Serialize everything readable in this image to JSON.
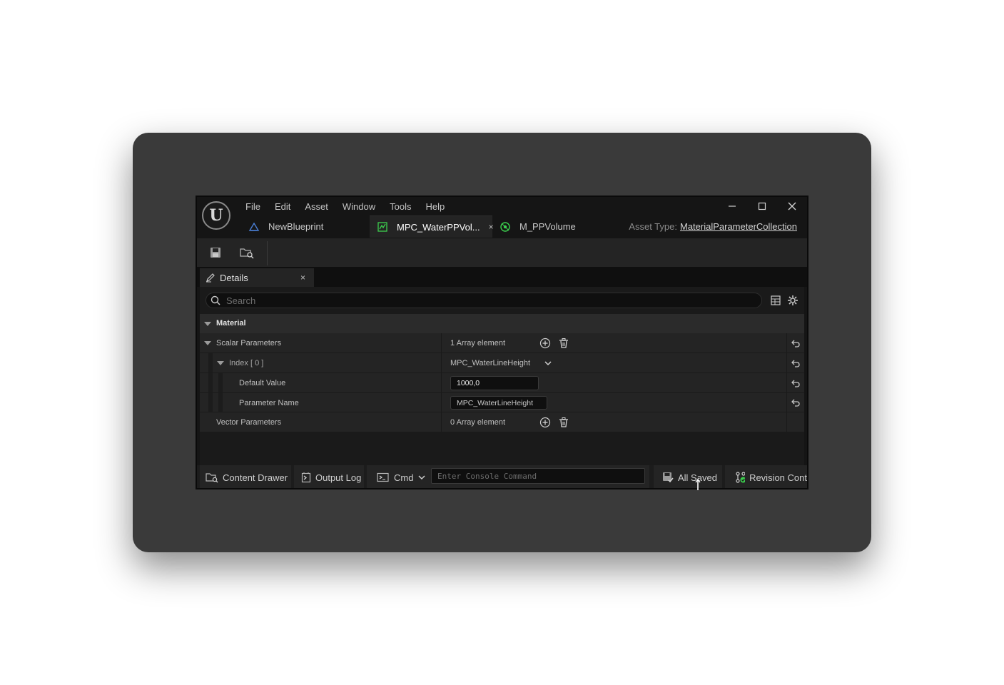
{
  "menu": [
    "File",
    "Edit",
    "Asset",
    "Window",
    "Tools",
    "Help"
  ],
  "tabs": [
    {
      "label": "NewBlueprint",
      "icon": "blueprint-icon"
    },
    {
      "label": "MPC_WaterPPVol...",
      "icon": "material-parameter-collection-icon",
      "close": "×"
    },
    {
      "label": "M_PPVolume",
      "icon": "material-icon"
    }
  ],
  "asset_type": {
    "label": "Asset Type:",
    "value": "MaterialParameterCollection"
  },
  "details": {
    "tab_label": "Details",
    "close": "×",
    "search_placeholder": "Search",
    "category": "Material",
    "scalar": {
      "label": "Scalar Parameters",
      "count": "1 Array element"
    },
    "index": {
      "label": "Index [ 0 ]",
      "value": "MPC_WaterLineHeight"
    },
    "default_value": {
      "label": "Default Value",
      "value": "1000,0"
    },
    "parameter_name": {
      "label": "Parameter Name",
      "value": "MPC_WaterLineHeight"
    },
    "vector": {
      "label": "Vector Parameters",
      "count": "0 Array element"
    }
  },
  "bottom": {
    "content_drawer": "Content Drawer",
    "output_log": "Output Log",
    "cmd": "Cmd",
    "console_placeholder": "Enter Console Command",
    "all_saved": "All Saved",
    "revision": "Revision Cont"
  },
  "colors": {
    "accent_green": "#3ccf4e",
    "blueprint_blue": "#4a7fd6",
    "window_bg": "#151515",
    "panel_bg": "#242424"
  }
}
